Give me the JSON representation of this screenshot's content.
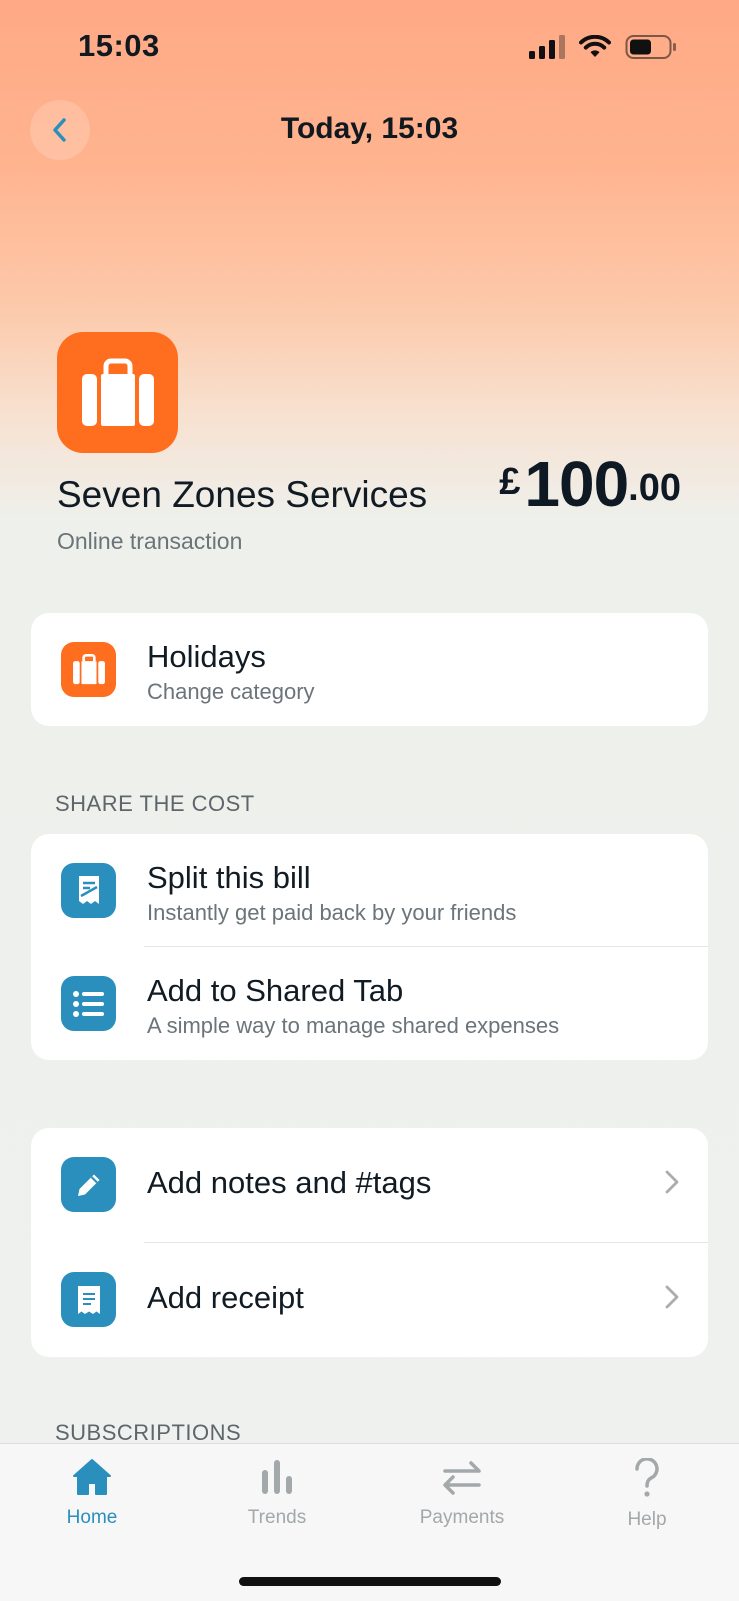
{
  "status_bar": {
    "time": "15:03"
  },
  "nav": {
    "title": "Today, 15:03"
  },
  "merchant": {
    "name": "Seven Zones Services",
    "subtitle": "Online transaction",
    "amount_currency": "£",
    "amount_major": "100",
    "amount_minor": ".00"
  },
  "category": {
    "title": "Holidays",
    "subtitle": "Change category"
  },
  "share_section": {
    "label": "SHARE THE COST",
    "items": [
      {
        "title": "Split this bill",
        "subtitle": "Instantly get paid back by your friends"
      },
      {
        "title": "Add to Shared Tab",
        "subtitle": "A simple way to manage shared expenses"
      }
    ]
  },
  "actions": [
    {
      "title": "Add notes and #tags"
    },
    {
      "title": "Add receipt"
    }
  ],
  "subscriptions_label": "SUBSCRIPTIONS",
  "tabs": [
    {
      "label": "Home",
      "active": true
    },
    {
      "label": "Trends",
      "active": false
    },
    {
      "label": "Payments",
      "active": false
    },
    {
      "label": "Help",
      "active": false
    }
  ],
  "colors": {
    "accent_orange": "#ff6e1f",
    "accent_blue": "#2a8fbd",
    "active_tab": "#2a8fbd",
    "inactive_tab": "#a3a8ab"
  }
}
